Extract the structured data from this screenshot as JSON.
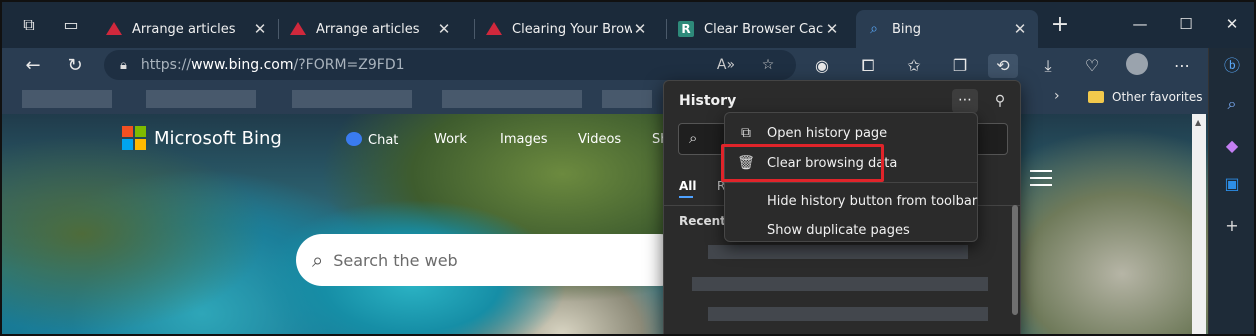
{
  "browser": {
    "tabs": [
      {
        "title": "Arrange articles",
        "icon": "red-triangle-icon",
        "active": false
      },
      {
        "title": "Arrange articles",
        "icon": "red-triangle-icon",
        "active": false
      },
      {
        "title": "Clearing Your Browser C",
        "icon": "red-triangle-icon",
        "active": false
      },
      {
        "title": "Clear Browser Cache | T",
        "icon": "r-logo-icon",
        "active": false
      },
      {
        "title": "Bing",
        "icon": "bing-search-icon",
        "active": true
      }
    ],
    "address": {
      "url_prefix": "https://",
      "url_host": "www.bing.com",
      "url_path": "/?FORM=Z9FD1"
    },
    "favorites_bar": {
      "other_favorites": "Other favorites"
    }
  },
  "bing": {
    "logo_text": "Microsoft Bing",
    "nav": [
      "Chat",
      "Work",
      "Images",
      "Videos",
      "Sh"
    ],
    "search_placeholder": "Search the web"
  },
  "history_panel": {
    "title": "History",
    "tabs": [
      "All",
      "R"
    ],
    "section_recent": "Recent"
  },
  "context_menu": {
    "items": [
      {
        "label": "Open history page",
        "icon": "open-external-icon"
      },
      {
        "label": "Clear browsing data",
        "icon": "trash-icon"
      },
      {
        "label": "Hide history button from toolbar",
        "icon": ""
      },
      {
        "label": "Show duplicate pages",
        "icon": ""
      }
    ]
  },
  "colors": {
    "accent": "#4ea1ff",
    "highlight_border": "#e0242a",
    "tab_bar": "#1b2a3a",
    "toolbar": "#2a3d52"
  }
}
